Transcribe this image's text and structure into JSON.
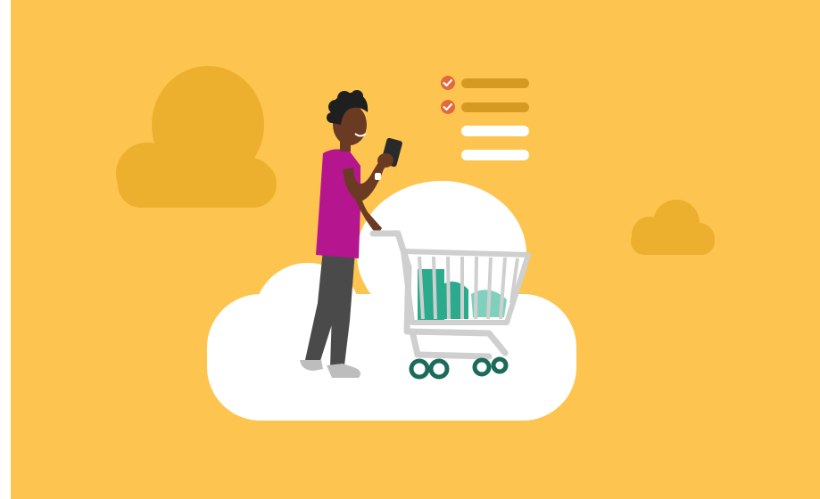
{
  "scene": {
    "description_icon": "shopping-illustration",
    "colors": {
      "background": "#FDC54F",
      "cloud_dark": "#EDAF2E",
      "cloud_white": "#FFFFFF",
      "checkbox": "#E2693C",
      "list_bar_done": "#D49A22",
      "list_bar_todo": "#FFFFFF",
      "shirt": "#B5158F",
      "pants": "#4A4A4A",
      "skin": "#6B3A22",
      "hair": "#1F1F1F",
      "cart": "#CFCFCF",
      "goods": "#2BAA8C",
      "wheels": "#1C6B5A"
    },
    "checklist": {
      "items": [
        {
          "checked": true
        },
        {
          "checked": true
        },
        {
          "checked": false
        },
        {
          "checked": false
        }
      ]
    }
  }
}
